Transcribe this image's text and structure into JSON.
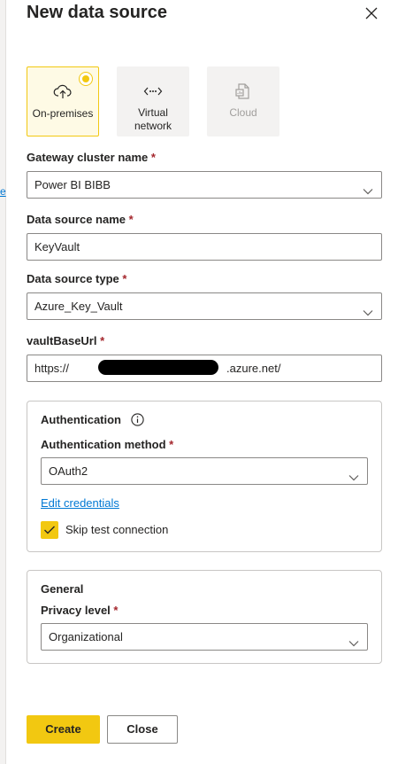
{
  "panel": {
    "title": "New data source",
    "background_link": "e"
  },
  "connection_types": [
    {
      "label": "On-premises",
      "icon": "cloud-upload-icon",
      "selected": true
    },
    {
      "label": "Virtual network",
      "icon": "network-icon",
      "selected": false
    },
    {
      "label": "Cloud",
      "icon": "cloud-report-icon",
      "selected": false,
      "disabled": true
    }
  ],
  "fields": {
    "gateway_cluster": {
      "label": "Gateway cluster name",
      "required_mark": "*",
      "value": "Power BI BIBB"
    },
    "data_source_name": {
      "label": "Data source name",
      "required_mark": "*",
      "value": "KeyVault"
    },
    "data_source_type": {
      "label": "Data source type",
      "required_mark": "*",
      "value": "Azure_Key_Vault"
    },
    "vault_base_url": {
      "label": "vaultBaseUrl",
      "required_mark": "*",
      "value_prefix": "https://",
      "value_suffix": ".azure.net/"
    }
  },
  "authentication": {
    "heading": "Authentication",
    "method_label": "Authentication method",
    "required_mark": "*",
    "method_value": "OAuth2",
    "edit_credentials": "Edit credentials",
    "skip_test_label": "Skip test connection",
    "skip_test_checked": true
  },
  "general": {
    "heading": "General",
    "privacy_label": "Privacy level",
    "required_mark": "*",
    "privacy_value": "Organizational"
  },
  "buttons": {
    "create": "Create",
    "close": "Close"
  },
  "colors": {
    "accent": "#f2c811",
    "link": "#0078d4",
    "required": "#a4262c"
  }
}
